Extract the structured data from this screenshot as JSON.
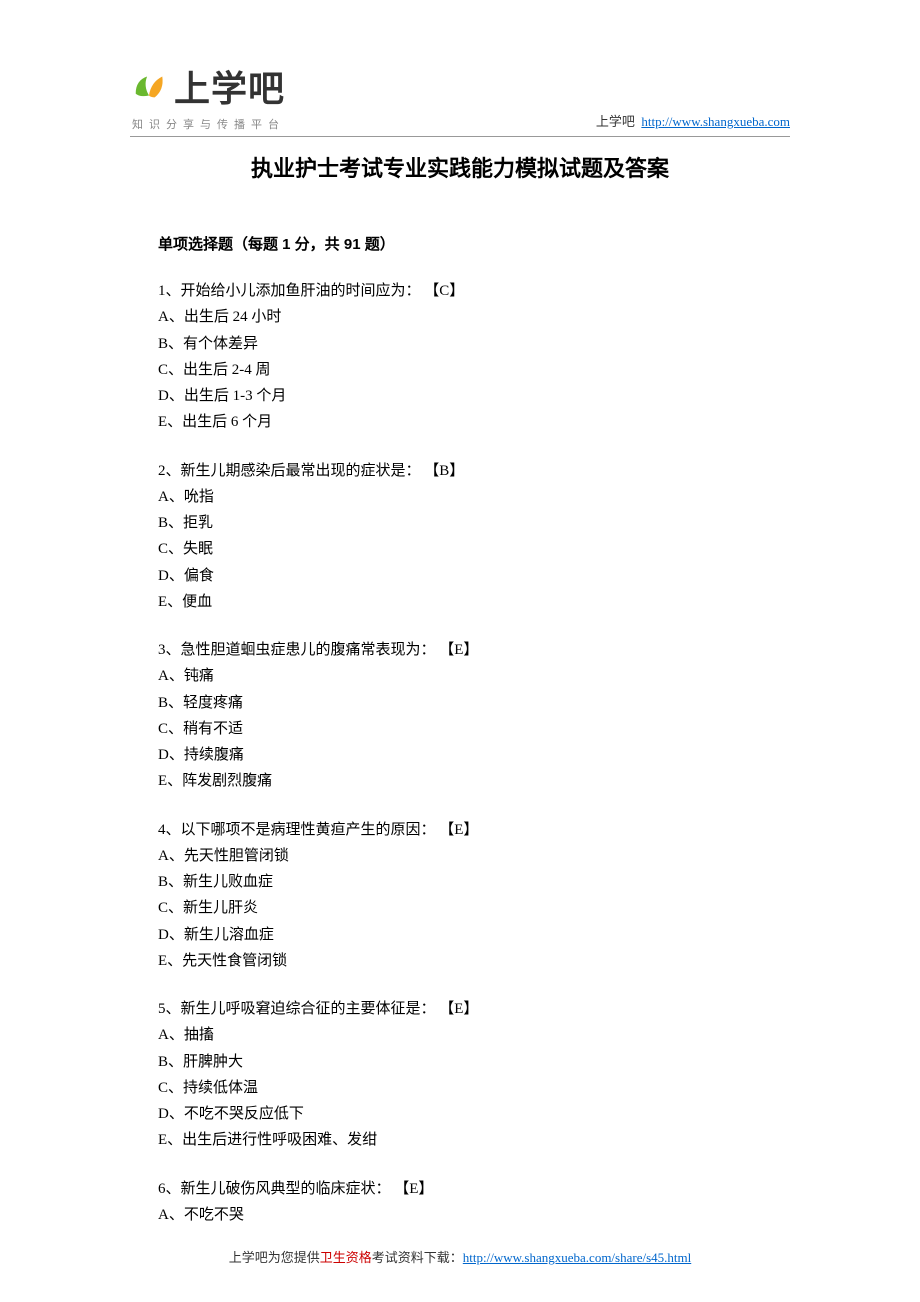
{
  "header": {
    "logo_text": "上学吧",
    "tagline": "知识分享与传播平台",
    "site_label": "上学吧",
    "site_url": "http://www.shangxueba.com"
  },
  "title": "执业护士考试专业实践能力模拟试题及答案",
  "section_header": "单项选择题（每题 1 分，共 91 题）",
  "questions": [
    {
      "num": "1",
      "stem": "开始给小儿添加鱼肝油的时间应为：",
      "answer": "【C】",
      "options": [
        "A、出生后 24 小时",
        "B、有个体差异",
        "C、出生后 2-4 周",
        "D、出生后 1-3 个月",
        "E、出生后 6 个月"
      ]
    },
    {
      "num": "2",
      "stem": "新生儿期感染后最常出现的症状是：",
      "answer": "【B】",
      "options": [
        "A、吮指",
        "B、拒乳",
        "C、失眠",
        "D、偏食",
        "E、便血"
      ]
    },
    {
      "num": "3",
      "stem": "急性胆道蛔虫症患儿的腹痛常表现为：",
      "answer": "【E】",
      "options": [
        "A、钝痛",
        "B、轻度疼痛",
        "C、稍有不适",
        "D、持续腹痛",
        "E、阵发剧烈腹痛"
      ]
    },
    {
      "num": "4",
      "stem": "以下哪项不是病理性黄疸产生的原因：",
      "answer": "【E】",
      "options": [
        "A、先天性胆管闭锁",
        "B、新生儿败血症",
        "C、新生儿肝炎",
        "D、新生儿溶血症",
        "E、先天性食管闭锁"
      ]
    },
    {
      "num": "5",
      "stem": "新生儿呼吸窘迫综合征的主要体征是：",
      "answer": "【E】",
      "options": [
        "A、抽搐",
        "B、肝脾肿大",
        "C、持续低体温",
        "D、不吃不哭反应低下",
        "E、出生后进行性呼吸困难、发绀"
      ]
    },
    {
      "num": "6",
      "stem": "新生儿破伤风典型的临床症状：",
      "answer": "【E】",
      "options": [
        "A、不吃不哭"
      ]
    }
  ],
  "footer": {
    "prefix": "上学吧为您提供",
    "highlight": "卫生资格",
    "suffix": "考试资料下载：",
    "url": "http://www.shangxueba.com/share/s45.html"
  }
}
